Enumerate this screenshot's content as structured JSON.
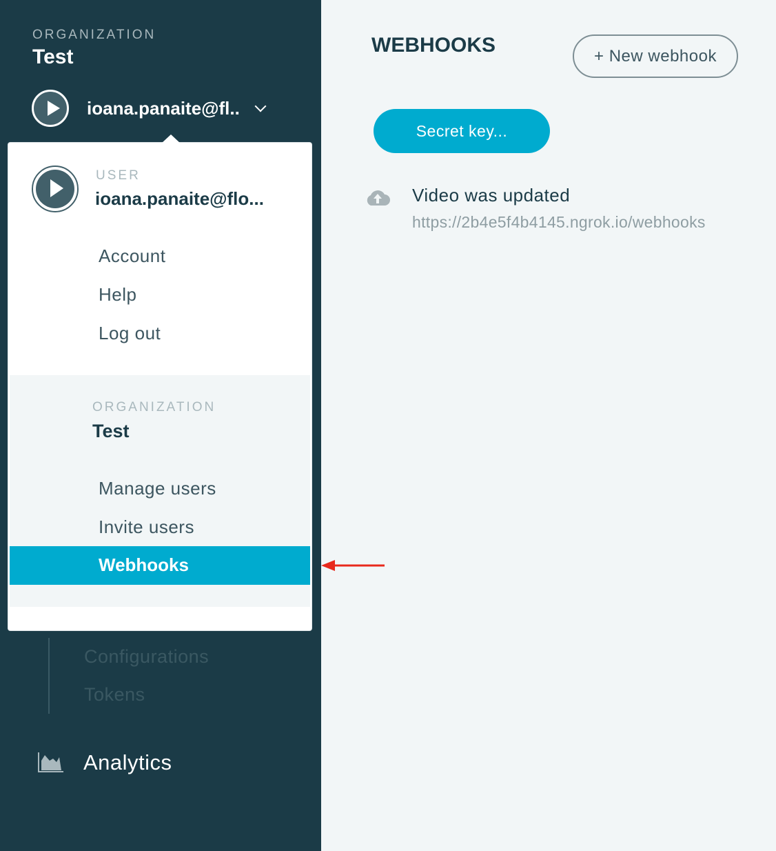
{
  "sidebar": {
    "org_label": "ORGANIZATION",
    "org_name": "Test",
    "user_email": "ioana.panaite@fl..",
    "sub_items": [
      "Configurations",
      "Tokens"
    ],
    "analytics_label": "Analytics"
  },
  "dropdown": {
    "user_label": "USER",
    "user_email": "ioana.panaite@flo...",
    "user_items": [
      "Account",
      "Help",
      "Log out"
    ],
    "org_label": "ORGANIZATION",
    "org_name": "Test",
    "org_items": [
      "Manage users",
      "Invite users"
    ],
    "active_item": "Webhooks"
  },
  "main": {
    "title": "WEBHOOKS",
    "new_button": "+ New webhook",
    "secret_button": "Secret key...",
    "webhooks": [
      {
        "event": "Video was updated",
        "url": "https://2b4e5f4b4145.ngrok.io/webhooks",
        "icon": "cloud-upload-icon"
      }
    ]
  },
  "colors": {
    "sidebar_bg": "#1b3b47",
    "accent": "#00abcf",
    "annotation_arrow": "#e8291c"
  }
}
